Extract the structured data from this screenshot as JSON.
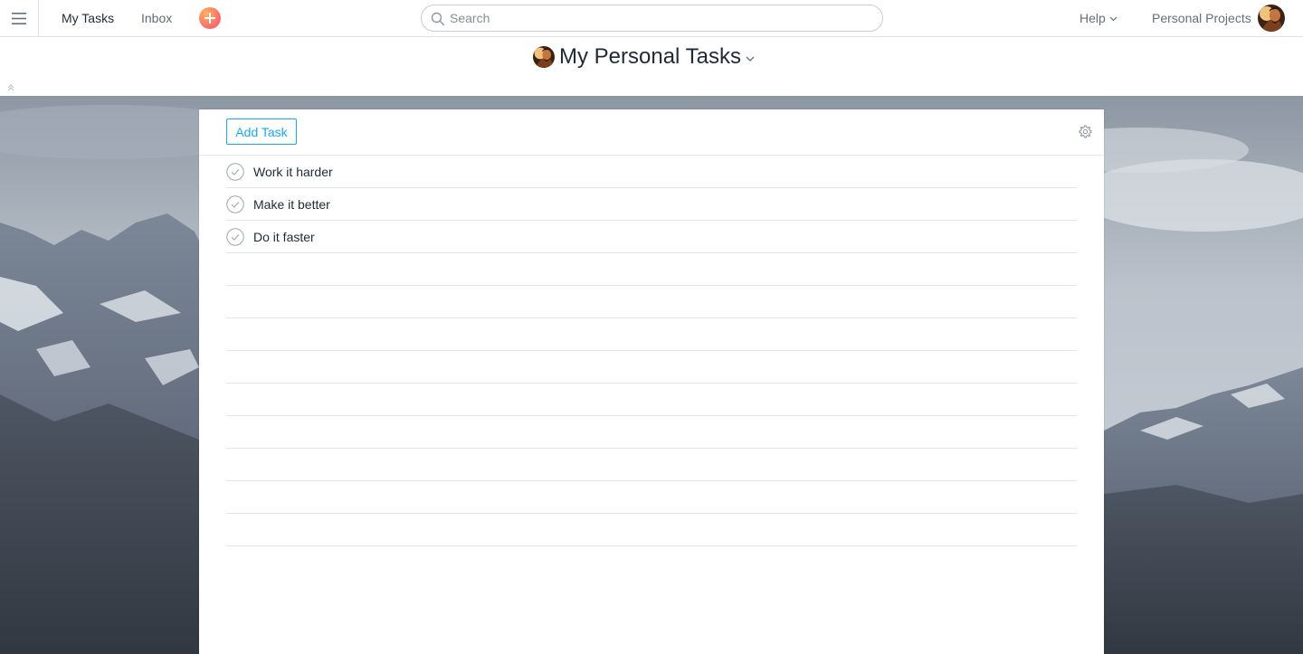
{
  "topbar": {
    "menu_icon": "hamburger-menu-icon",
    "nav": [
      {
        "label": "My Tasks"
      },
      {
        "label": "Inbox"
      }
    ],
    "quick_add_icon": "plus-icon",
    "search": {
      "placeholder": "Search",
      "value": ""
    },
    "help_label": "Help",
    "org_label": "Personal Projects"
  },
  "project": {
    "title": "My Personal Tasks"
  },
  "toolbar": {
    "add_task_label": "Add Task",
    "settings_icon": "gear-icon"
  },
  "tasks": [
    {
      "name": "Work it harder"
    },
    {
      "name": "Make it better"
    },
    {
      "name": "Do it faster"
    },
    {
      "name": ""
    },
    {
      "name": ""
    },
    {
      "name": ""
    },
    {
      "name": ""
    },
    {
      "name": ""
    },
    {
      "name": ""
    },
    {
      "name": ""
    },
    {
      "name": ""
    },
    {
      "name": ""
    }
  ],
  "colors": {
    "accent": "#14aaf5",
    "quick_add": "#fc7868",
    "text": "#1f2a36"
  }
}
